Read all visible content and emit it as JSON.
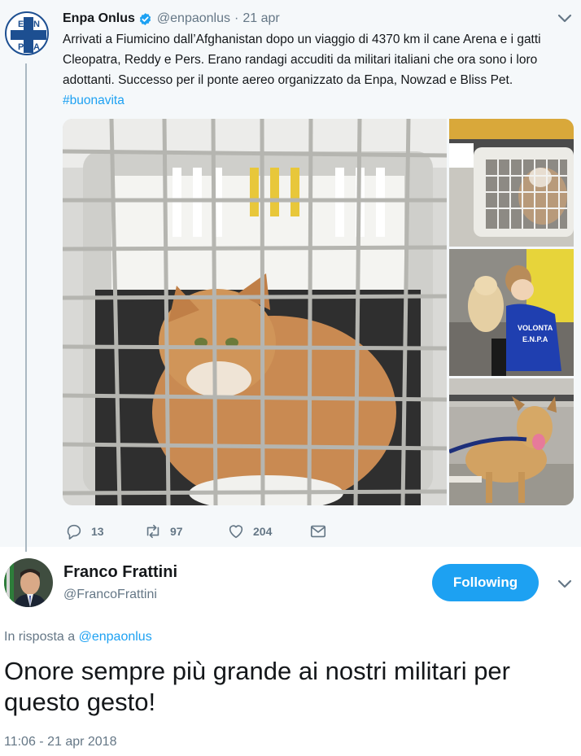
{
  "quoted_tweet": {
    "author_name": "Enpa Onlus",
    "author_handle": "@enpaonlus",
    "separator": "·",
    "date": "21 apr",
    "text": "Arrivati a Fiumicino dall’Afghanistan dopo un viaggio di 4370 km il cane Arena e i gatti Cleopatra, Reddy e Pers. Erano randagi accuditi da militari italiani che ora sono i loro adottanti. Successo per il ponte aereo organizzato da Enpa, Nowzad e Bliss Pet. ",
    "hashtag": "#buonavita",
    "avatar_letters": [
      "E",
      "N",
      "P",
      "A"
    ],
    "photo_badge_text": [
      "VOLONTA",
      "E.N.P.A"
    ],
    "actions": {
      "reply_count": "13",
      "retweet_count": "97",
      "like_count": "204"
    },
    "icons": [
      "verified-badge-icon",
      "chevron-down-icon",
      "reply-icon",
      "retweet-icon",
      "like-icon",
      "message-icon"
    ]
  },
  "main_tweet": {
    "author_name": "Franco Frattini",
    "author_handle": "@FrancoFrattini",
    "follow_button_label": "Following",
    "reply_prefix": "In risposta a ",
    "reply_handle": "@enpaonlus",
    "text": "Onore sempre più grande ai nostri militari per questo gesto!",
    "timestamp": "11:06 - 21 apr 2018"
  },
  "colors": {
    "accent": "#1da1f2",
    "text": "#14171a",
    "secondary_text": "#657786",
    "quoted_background": "#f5f8fa",
    "enpa_blue": "#1d4f91"
  }
}
